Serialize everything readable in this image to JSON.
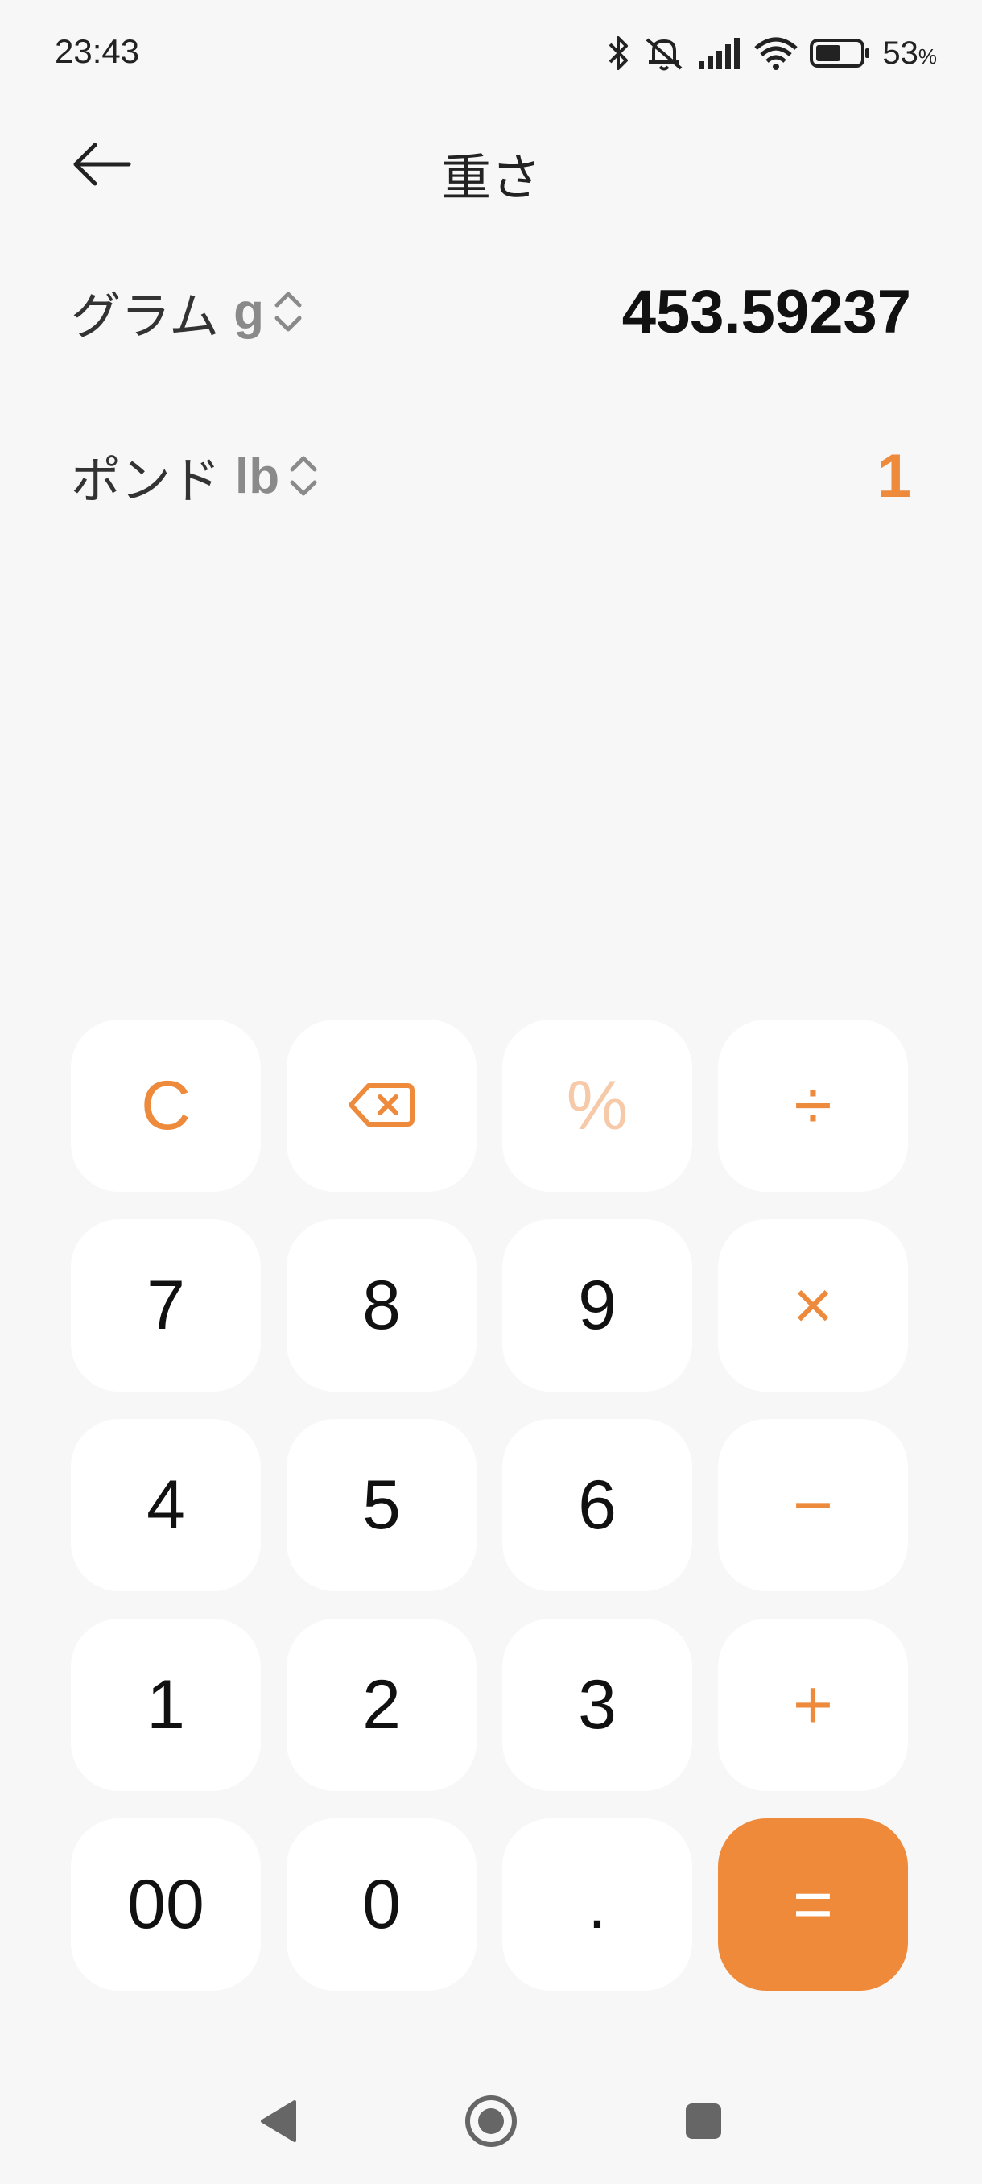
{
  "status_bar": {
    "time": "23:43",
    "battery_percent": "53",
    "battery_unit": "%",
    "icons": [
      "bluetooth-icon",
      "mute-icon",
      "signal-icon",
      "wifi-icon",
      "battery-icon"
    ]
  },
  "header": {
    "title": "重さ",
    "back_icon": "arrow-left-icon"
  },
  "units": [
    {
      "name": "グラム",
      "symbol": "g",
      "value": "453.59237",
      "active": false
    },
    {
      "name": "ポンド",
      "symbol": "lb",
      "value": "1",
      "active": true
    }
  ],
  "keypad": {
    "clear": "C",
    "backspace_icon": "backspace-icon",
    "percent": "%",
    "divide": "÷",
    "seven": "7",
    "eight": "8",
    "nine": "9",
    "multiply": "×",
    "four": "4",
    "five": "5",
    "six": "6",
    "minus": "−",
    "one": "1",
    "two": "2",
    "three": "3",
    "plus": "+",
    "double_zero": "00",
    "zero": "0",
    "decimal": ".",
    "equals": "="
  },
  "colors": {
    "accent": "#EE8A3C",
    "background": "#F7F7F7",
    "key_background": "#FFFFFF",
    "disabled_accent": "#F6C9A9"
  },
  "nav_bar": {
    "icons": [
      "back-triangle-icon",
      "home-circle-icon",
      "recents-square-icon"
    ]
  }
}
